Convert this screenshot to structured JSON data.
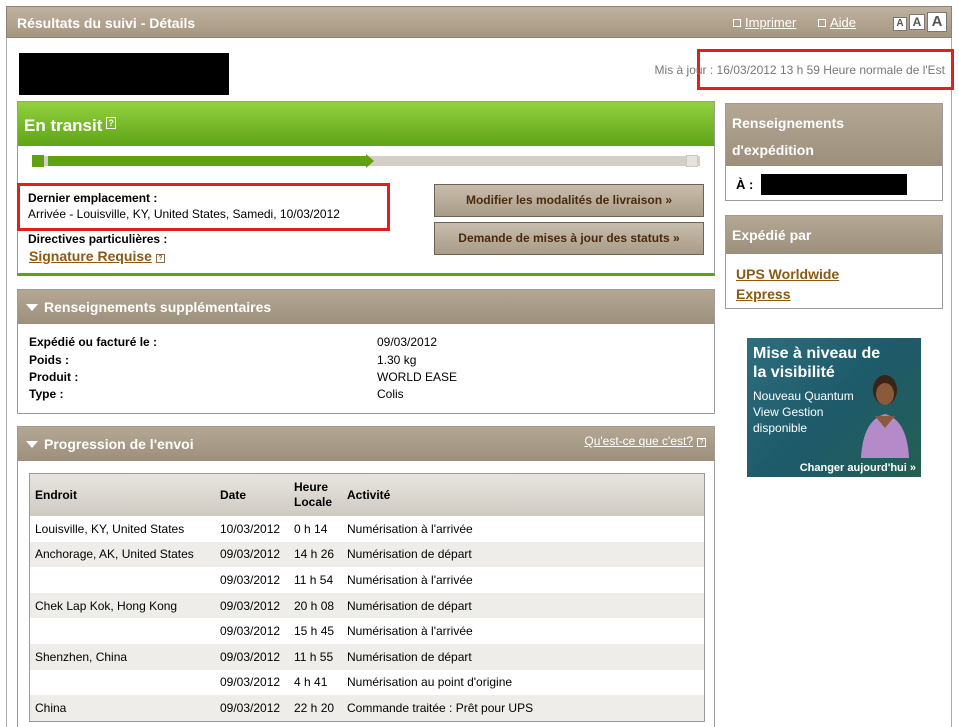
{
  "header": {
    "title": "Résultats du suivi - Détails",
    "print_label": "Imprimer",
    "help_label": "Aide",
    "text_sizes": [
      "A",
      "A",
      "A"
    ]
  },
  "updated": "Mis à jour : 16/03/2012 13 h 59 Heure normale de l'Est",
  "status": {
    "title": "En transit",
    "help_icon": "?",
    "progress": 0.5,
    "last_location_label": "Dernier emplacement :",
    "last_location_value": "Arrivée - Louisville, KY, United States, Samedi, 10/03/2012",
    "special_instructions_label": "Directives particulières :",
    "special_instructions_link": "Signature Requise",
    "modify_button": "Modifier les modalités de livraison »",
    "status_updates_button": "Demande de mises à jour des statuts »"
  },
  "additional_info": {
    "title": "Renseignements supplémentaires",
    "rows": [
      {
        "label": "Expédié ou facturé le :",
        "value": "09/03/2012"
      },
      {
        "label": "Poids :",
        "value": "1.30 kg"
      },
      {
        "label": "Produit :",
        "value": "WORLD EASE"
      },
      {
        "label": "Type :",
        "value": "Colis"
      }
    ]
  },
  "progress_section": {
    "title": "Progression de l'envoi",
    "what_is_this": "Qu'est-ce que c'est?",
    "columns": {
      "location": "Endroit",
      "date": "Date",
      "time_line1": "Heure",
      "time_line2": "Locale",
      "activity": "Activité"
    },
    "rows": [
      {
        "location": "Louisville, KY, United States",
        "date": "10/03/2012",
        "time": "0 h 14",
        "activity": "Numérisation à l'arrivée"
      },
      {
        "location": "Anchorage, AK, United States",
        "date": "09/03/2012",
        "time": "14 h 26",
        "activity": "Numérisation de départ"
      },
      {
        "location": "",
        "date": "09/03/2012",
        "time": "11 h 54",
        "activity": "Numérisation à l'arrivée"
      },
      {
        "location": "Chek Lap Kok, Hong Kong",
        "date": "09/03/2012",
        "time": "20 h 08",
        "activity": "Numérisation de départ"
      },
      {
        "location": "",
        "date": "09/03/2012",
        "time": "15 h 45",
        "activity": "Numérisation à l'arrivée"
      },
      {
        "location": "Shenzhen, China",
        "date": "09/03/2012",
        "time": "11 h 55",
        "activity": "Numérisation de départ"
      },
      {
        "location": "",
        "date": "09/03/2012",
        "time": "4 h 41",
        "activity": "Numérisation au point d'origine"
      },
      {
        "location": "China",
        "date": "09/03/2012",
        "time": "22 h 20",
        "activity": "Commande traitée : Prêt pour UPS"
      }
    ]
  },
  "shipment_info": {
    "title_line1": "Renseignements",
    "title_line2": "d'expédition",
    "to_label": "À :"
  },
  "shipped_by": {
    "title": "Expédié par",
    "link_line1": "UPS Worldwide",
    "link_line2": "Express"
  },
  "ad": {
    "title_line1": "Mise à niveau de",
    "title_line2": "la visibilité",
    "sub_line1": "Nouveau Quantum",
    "sub_line2": "View Gestion",
    "sub_line3": "disponible",
    "cta": "Changer aujourd'hui »"
  }
}
